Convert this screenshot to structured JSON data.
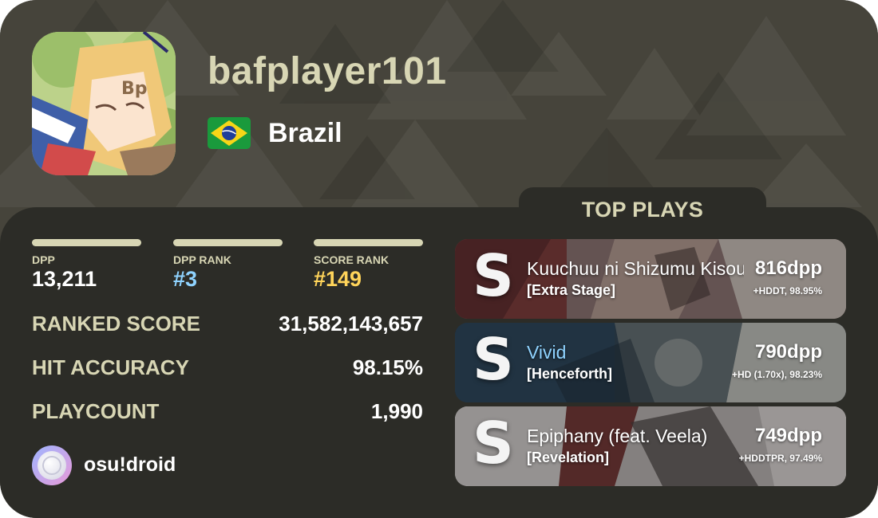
{
  "profile": {
    "username": "bafplayer101",
    "country": "Brazil",
    "flag_icon": "brazil-flag-icon",
    "avatar_icon": "anime-avatar-image"
  },
  "stats": {
    "dpp": {
      "label": "DPP",
      "value": "13,211",
      "color": "#ffffff"
    },
    "dpp_rank": {
      "label": "DPP RANK",
      "value": "#3",
      "color": "#8fd3ff"
    },
    "score_rank": {
      "label": "SCORE RANK",
      "value": "#149",
      "color": "#ffd45a"
    }
  },
  "rows": [
    {
      "label": "RANKED SCORE",
      "value": "31,582,143,657"
    },
    {
      "label": "HIT ACCURACY",
      "value": "98.15%"
    },
    {
      "label": "PLAYCOUNT",
      "value": "1,990"
    }
  ],
  "client": {
    "name": "osu!droid",
    "icon": "osu-droid-logo-icon"
  },
  "top_plays": {
    "title": "TOP PLAYS",
    "plays": [
      {
        "grade": "S",
        "title": "Kuuchuu ni Shizumu Kisou",
        "difficulty": "[Extra Stage]",
        "pp": "816dpp",
        "mods": "+HDDT, 98.95%",
        "title_color": "#ffffff"
      },
      {
        "grade": "S",
        "title": "Vivid",
        "difficulty": "[Henceforth]",
        "pp": "790dpp",
        "mods": "+HD (1.70x), 98.23%",
        "title_color": "#8fd3ff"
      },
      {
        "grade": "S",
        "title": "Epiphany (feat. Veela)",
        "difficulty": "[Revelation]",
        "pp": "749dpp",
        "mods": "+HDDTPR, 97.49%",
        "title_color": "#ffffff"
      }
    ]
  },
  "colors": {
    "accent": "#d8d6b4",
    "background": "#46443b",
    "panel": "#2c2c27"
  }
}
